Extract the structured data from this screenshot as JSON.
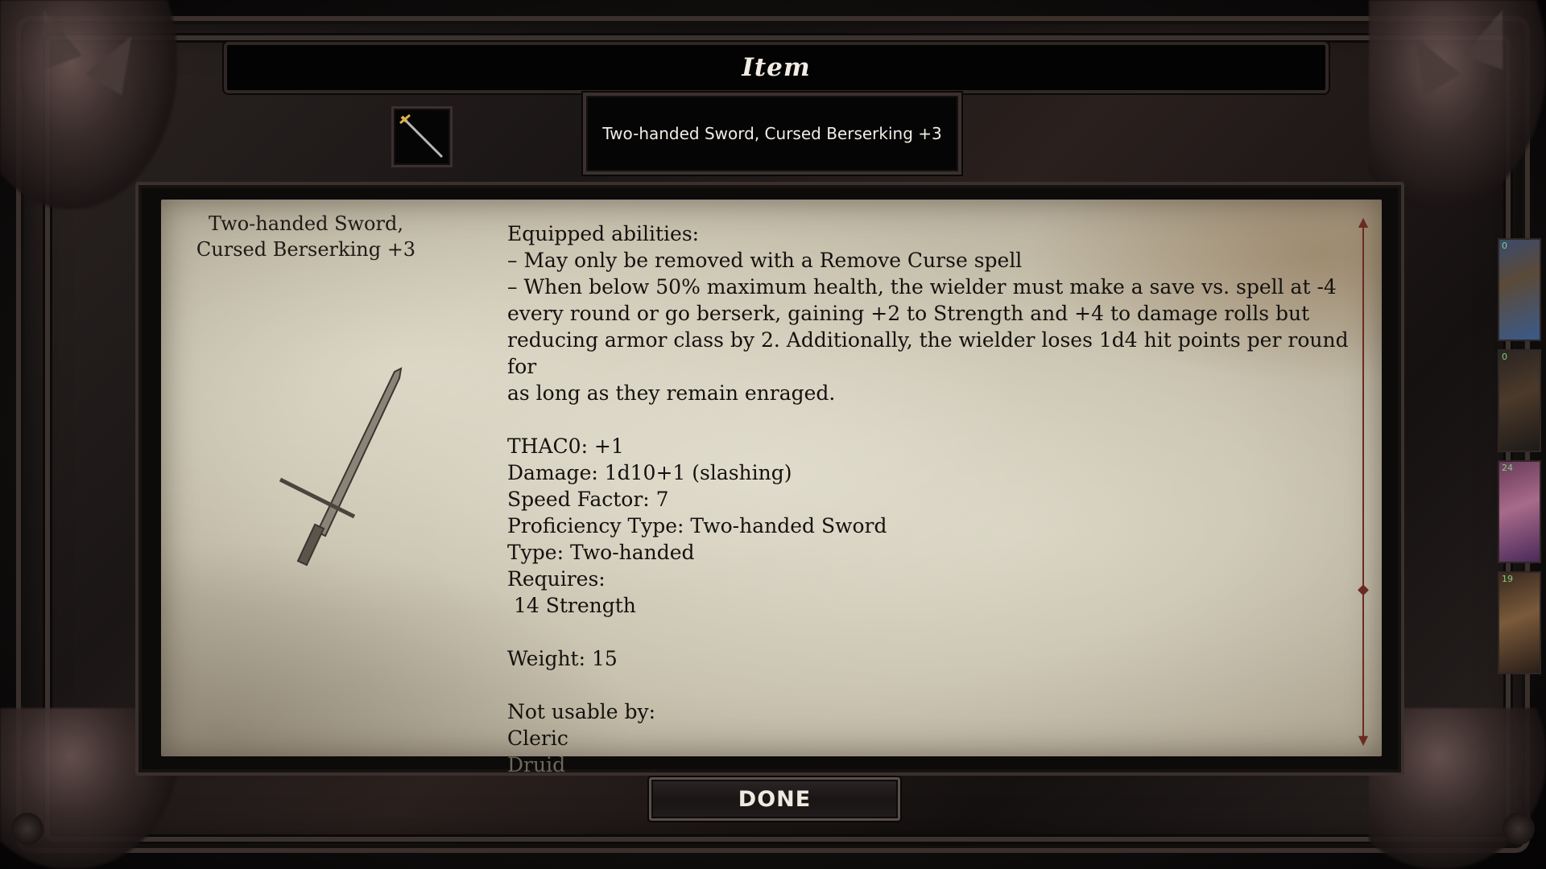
{
  "window": {
    "title": "Item"
  },
  "item": {
    "name_box": "Two-handed Sword, Cursed Berserking +3",
    "parchment_title": "Two-handed Sword, Cursed Berserking +3",
    "icon": "sword-icon",
    "art": "sword-art"
  },
  "description": {
    "lines": [
      "Equipped abilities:",
      "– May only be removed with a Remove Curse spell",
      "– When below 50% maximum health, the wielder must make a save vs. spell at -4",
      "every round or go berserk, gaining +2 to Strength and +4 to damage rolls but",
      "reducing armor class by 2. Additionally, the wielder loses 1d4 hit points per round for",
      "as long as they remain enraged.",
      "",
      "THAC0: +1",
      "Damage: 1d10+1 (slashing)",
      "Speed Factor: 7",
      "Proficiency Type: Two-handed Sword",
      "Type: Two-handed",
      "Requires:",
      " 14 Strength",
      "",
      "Weight: 15",
      "",
      "Not usable by:",
      "Cleric",
      "Druid"
    ]
  },
  "buttons": {
    "done": "DONE"
  },
  "portraits": [
    {
      "hp": "0"
    },
    {
      "hp": "0"
    },
    {
      "hp": "24"
    },
    {
      "hp": "19"
    }
  ],
  "colors": {
    "parchment": "#c7c0ad",
    "text_dark": "#14110e",
    "scroll_accent": "#6b2b22",
    "title_text": "#f2ede4"
  }
}
